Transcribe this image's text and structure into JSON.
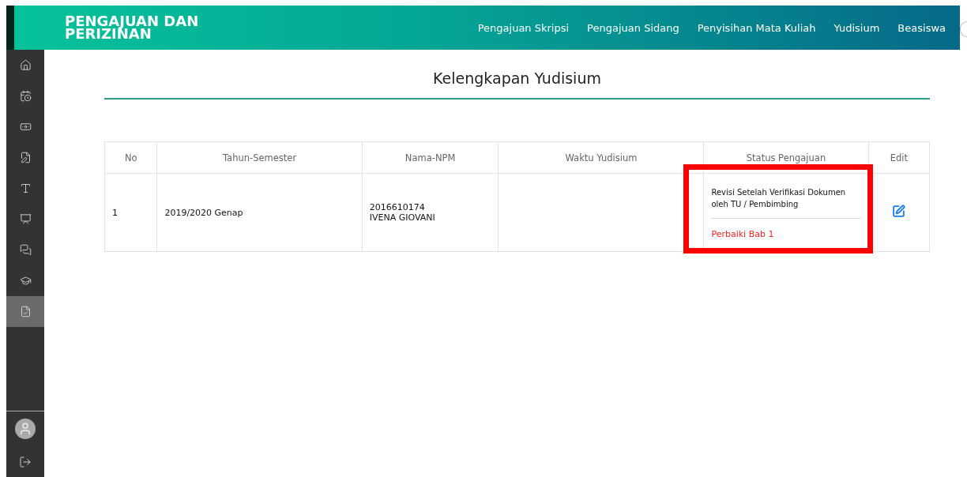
{
  "header": {
    "title_lines": [
      "PENGAJUAN DAN",
      "PERIZINAN"
    ],
    "nav": [
      {
        "label": "Pengajuan Skripsi"
      },
      {
        "label": "Pengajuan Sidang"
      },
      {
        "label": "Penyisihan Mata Kuliah"
      },
      {
        "label": "Yudisium"
      },
      {
        "label": "Beasiswa"
      }
    ]
  },
  "sidebar": {
    "items": [
      {
        "kind": "home",
        "selected": false
      },
      {
        "kind": "calendar",
        "selected": false
      },
      {
        "kind": "money",
        "selected": false
      },
      {
        "kind": "document",
        "selected": false
      },
      {
        "kind": "font",
        "selected": false
      },
      {
        "kind": "presentation",
        "selected": false
      },
      {
        "kind": "chat",
        "selected": false
      },
      {
        "kind": "graduation",
        "selected": false
      },
      {
        "kind": "checklist",
        "selected": true
      }
    ]
  },
  "page_title": "Kelengkapan Yudisium",
  "table": {
    "columns": [
      "No",
      "Tahun-Semester",
      "Nama-NPM",
      "Waktu Yudisium",
      "Status Pengajuan",
      "Edit"
    ],
    "rows": [
      {
        "no": "1",
        "semester": "2019/2020 Genap",
        "npm": "2016610174",
        "name": "IVENA GIOVANI",
        "status": "Revisi Setelah Verifikasi Dokumen oleh TU / Pembimbing",
        "note": "Perbaiki Bab 1",
        "highlighted": true
      }
    ]
  }
}
